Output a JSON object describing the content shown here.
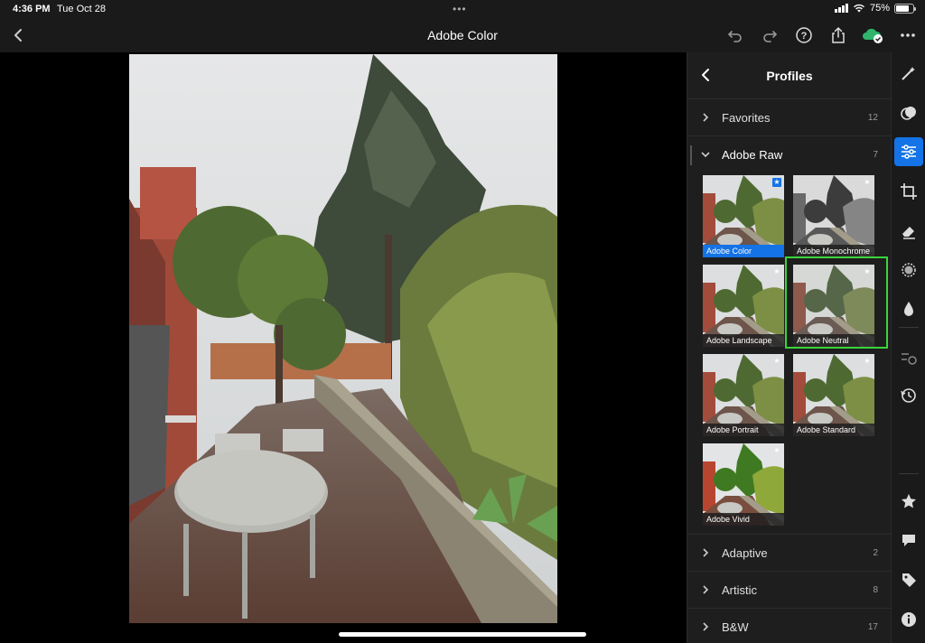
{
  "status_bar": {
    "time": "4:36 PM",
    "date": "Tue Oct 28",
    "battery": "75%",
    "battery_level": 0.75
  },
  "toolbar": {
    "title": "Adobe Color",
    "icons": [
      "back-icon",
      "undo-icon",
      "redo-icon",
      "help-icon",
      "share-icon",
      "cloud-sync-icon",
      "more-icon"
    ]
  },
  "panel": {
    "title": "Profiles",
    "groups_top": [
      {
        "label": "Favorites",
        "count": "12",
        "expanded": false
      },
      {
        "label": "Adobe Raw",
        "count": "7",
        "expanded": true
      }
    ],
    "profiles": [
      {
        "label": "Adobe Color",
        "selected": true,
        "style": "color"
      },
      {
        "label": "Adobe Monochrome",
        "selected": false,
        "style": "mono"
      },
      {
        "label": "Adobe Landscape",
        "selected": false,
        "style": "color"
      },
      {
        "label": "Adobe Neutral",
        "selected": false,
        "style": "neutral",
        "highlighted": true
      },
      {
        "label": "Adobe Portrait",
        "selected": false,
        "style": "color"
      },
      {
        "label": "Adobe Standard",
        "selected": false,
        "style": "color"
      },
      {
        "label": "Adobe Vivid",
        "selected": false,
        "style": "vivid"
      }
    ],
    "groups_bottom": [
      {
        "label": "Adaptive",
        "count": "2"
      },
      {
        "label": "Artistic",
        "count": "8"
      },
      {
        "label": "B&W",
        "count": "17"
      }
    ]
  },
  "rail": {
    "items": [
      {
        "name": "auto-enhance-icon",
        "active": false
      },
      {
        "name": "masking-icon",
        "active": false
      },
      {
        "name": "adjustments-icon",
        "active": true
      },
      {
        "name": "crop-icon",
        "active": false
      },
      {
        "name": "remove-eraser-icon",
        "active": false
      },
      {
        "name": "effects-vignette-icon",
        "active": false
      },
      {
        "name": "color-drop-icon",
        "active": false
      },
      {
        "name": "presets-icon",
        "active": false
      },
      {
        "name": "versions-history-icon",
        "active": false
      },
      {
        "name": "rate-star-icon",
        "active": false
      },
      {
        "name": "comments-icon",
        "active": false
      },
      {
        "name": "keywords-tag-icon",
        "active": false
      },
      {
        "name": "info-icon",
        "active": false
      }
    ]
  },
  "colors": {
    "accent": "#1473e6",
    "highlight": "#39d53a",
    "panel_bg": "#1e1e1e"
  }
}
